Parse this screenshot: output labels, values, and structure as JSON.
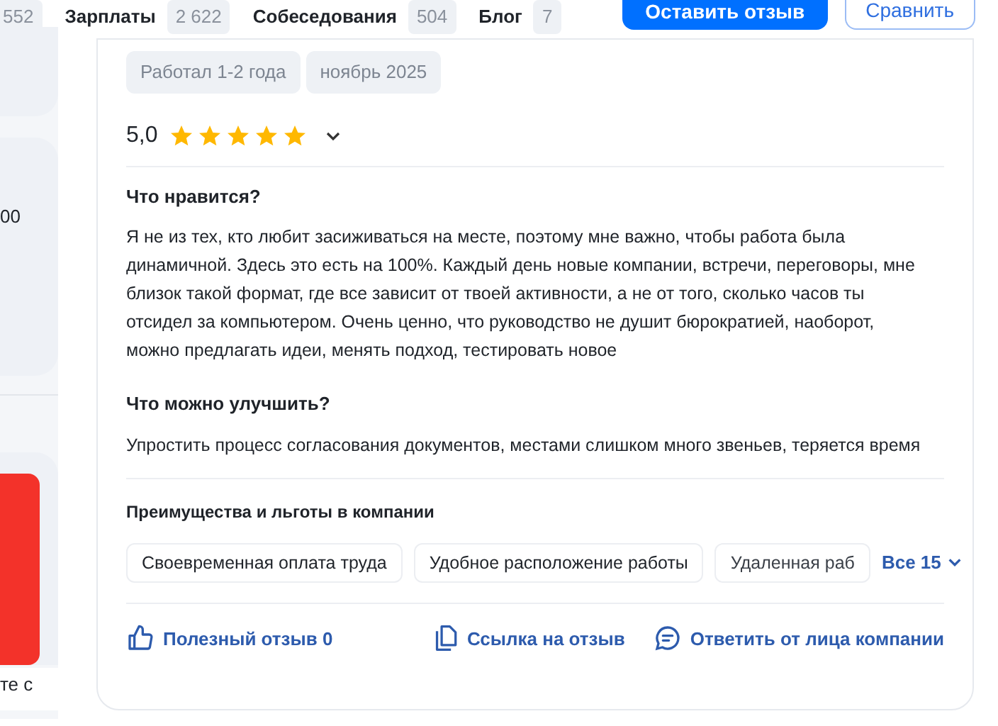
{
  "nav": {
    "items": [
      {
        "count": "552"
      },
      {
        "label": "Зарплаты",
        "count": "2 622"
      },
      {
        "label": "Собеседования",
        "count": "504"
      },
      {
        "label": "Блог",
        "count": "7"
      }
    ],
    "buttons": [
      {
        "label": "Оставить отзыв",
        "kind": "primary"
      },
      {
        "label": "Сравнить",
        "kind": "outline"
      }
    ]
  },
  "sidebar": {
    "texts": [
      "00",
      "те с"
    ]
  },
  "review": {
    "tags": [
      "Работал 1-2 года",
      "ноябрь 2025"
    ],
    "rating": "5,0",
    "stars": 5,
    "sections": [
      {
        "title": "Что нравится?",
        "text": "Я не из тех, кто любит засиживаться на месте, поэтому мне важно, чтобы работа была динамичной. Здесь это есть на 100%. Каждый день новые компании, встречи, переговоры, мне близок такой формат, где все зависит от твоей активности, а не от того, сколько часов ты отсидел за компьютером. Очень ценно, что руководство не душит бюрократией, наоборот, можно предлагать идеи, менять подход, тестировать новое"
      },
      {
        "title": "Что можно улучшить?",
        "text": "Упростить процесс согласования документов, местами слишком много звеньев, теряется время"
      }
    ],
    "benefits": {
      "title": "Преимущества и льготы в компании",
      "items": [
        "Своевременная оплата труда",
        "Удобное расположение работы",
        "Удаленная раб"
      ],
      "more": "Все 15"
    },
    "actions": [
      {
        "kind": "like",
        "label": "Полезный отзыв 0"
      },
      {
        "kind": "link",
        "label": "Ссылка на отзыв"
      },
      {
        "kind": "reply",
        "label": "Ответить от лица компании"
      }
    ]
  }
}
